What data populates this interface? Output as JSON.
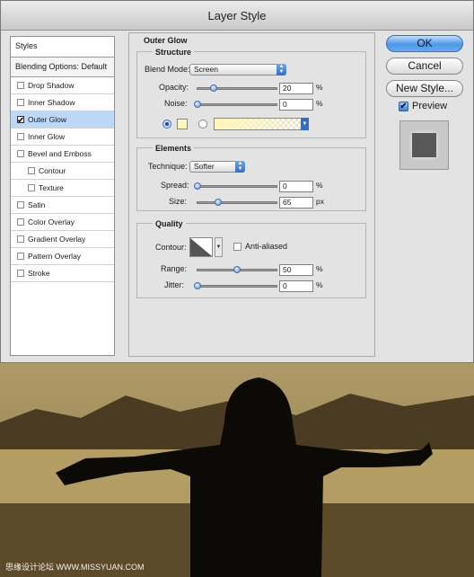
{
  "dialog": {
    "title": "Layer Style"
  },
  "styles_list": {
    "header": "Styles",
    "blending": "Blending Options: Default",
    "items": [
      {
        "label": "Drop Shadow",
        "checked": false,
        "indent": false
      },
      {
        "label": "Inner Shadow",
        "checked": false,
        "indent": false
      },
      {
        "label": "Outer Glow",
        "checked": true,
        "indent": false,
        "selected": true
      },
      {
        "label": "Inner Glow",
        "checked": false,
        "indent": false
      },
      {
        "label": "Bevel and Emboss",
        "checked": false,
        "indent": false
      },
      {
        "label": "Contour",
        "checked": false,
        "indent": true
      },
      {
        "label": "Texture",
        "checked": false,
        "indent": true
      },
      {
        "label": "Satin",
        "checked": false,
        "indent": false
      },
      {
        "label": "Color Overlay",
        "checked": false,
        "indent": false
      },
      {
        "label": "Gradient Overlay",
        "checked": false,
        "indent": false
      },
      {
        "label": "Pattern Overlay",
        "checked": false,
        "indent": false
      },
      {
        "label": "Stroke",
        "checked": false,
        "indent": false
      }
    ]
  },
  "outer_glow": {
    "title": "Outer Glow",
    "structure": {
      "title": "Structure",
      "blend_mode_label": "Blend Mode:",
      "blend_mode": "Screen",
      "opacity_label": "Opacity:",
      "opacity": "20",
      "opacity_fraction": 0.2,
      "noise_label": "Noise:",
      "noise": "0",
      "noise_fraction": 0,
      "percent": "%",
      "glow_color": "#fff7b8"
    },
    "elements": {
      "title": "Elements",
      "technique_label": "Technique:",
      "technique": "Softer",
      "spread_label": "Spread:",
      "spread": "0",
      "spread_fraction": 0,
      "size_label": "Size:",
      "size": "65",
      "size_fraction": 0.26,
      "percent": "%",
      "px": "px"
    },
    "quality": {
      "title": "Quality",
      "contour_label": "Contour:",
      "anti_aliased": "Anti-aliased",
      "range_label": "Range:",
      "range": "50",
      "range_fraction": 0.5,
      "jitter_label": "Jitter:",
      "jitter": "0",
      "jitter_fraction": 0,
      "percent": "%"
    }
  },
  "buttons": {
    "ok": "OK",
    "cancel": "Cancel",
    "new_style": "New Style...",
    "preview": "Preview"
  },
  "watermark": "思缘设计论坛 WWW.MISSYUAN.COM"
}
